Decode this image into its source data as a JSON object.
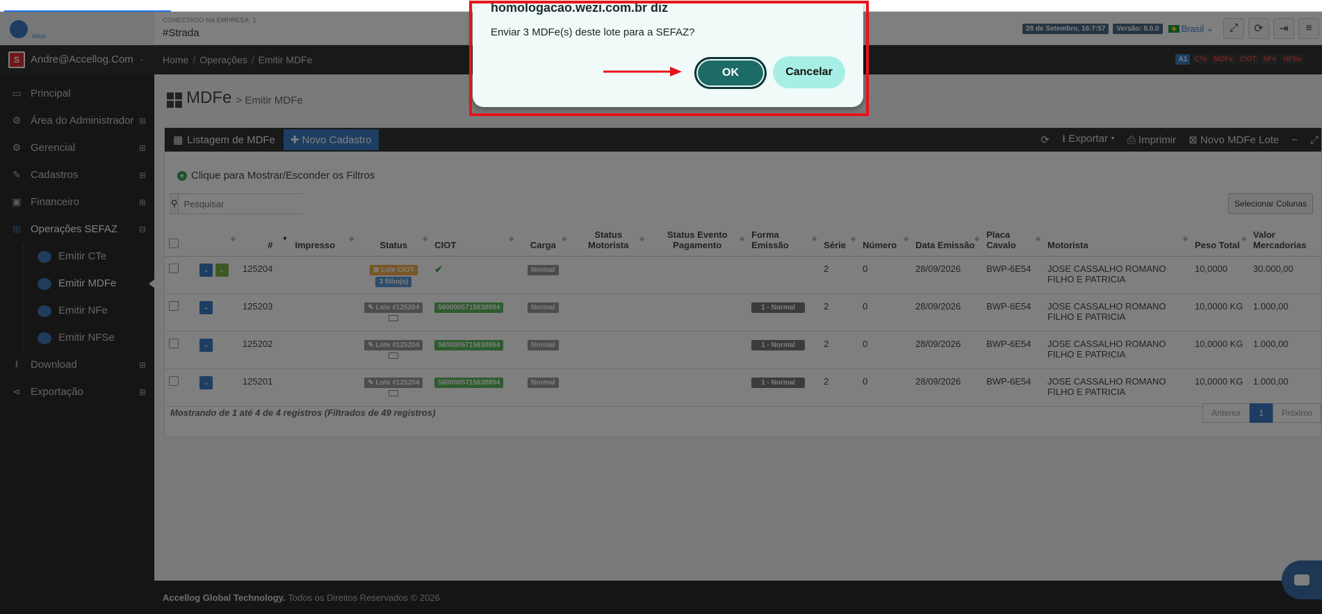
{
  "dialog": {
    "title": "homologacao.wezi.com.br diz",
    "message": "Enviar 3 MDFe(s) deste lote para a SEFAZ?",
    "ok_label": "OK",
    "cancel_label": "Cancelar"
  },
  "header": {
    "logo_text": "Wezi",
    "company_label": "CONECTADO NA EMPRESA: 1",
    "company_name": "#Strada",
    "date_badge": "28 de Setembro, 16:7:57",
    "version_badge": "Versão: 8.0.0",
    "country": "Brasil"
  },
  "sidebar": {
    "user": "Andre@Accellog.Com",
    "user_badge": "S",
    "items": [
      {
        "label": "Principal",
        "icon": "monitor-icon"
      },
      {
        "label": "Área do Administrador",
        "icon": "cogs-icon"
      },
      {
        "label": "Gerencial",
        "icon": "cogs-icon"
      },
      {
        "label": "Cadastros",
        "icon": "edit-icon"
      },
      {
        "label": "Financeiro",
        "icon": "money-icon"
      },
      {
        "label": "Operações SEFAZ",
        "icon": "windows-icon"
      },
      {
        "label": "Download",
        "icon": "download-icon"
      },
      {
        "label": "Exportação",
        "icon": "share-icon"
      }
    ],
    "sub_items": [
      {
        "label": "Emitir CTe",
        "tag": "CTe"
      },
      {
        "label": "Emitir MDFe",
        "tag": "MDFe"
      },
      {
        "label": "Emitir NFe",
        "tag": "NFe"
      },
      {
        "label": "Emitir NFSe",
        "tag": "NFSe"
      }
    ]
  },
  "breadcrumb": [
    "Home",
    "Operações",
    "Emitir MDFe"
  ],
  "quick_links": [
    "A1",
    "CTe",
    "MDFe",
    "CIOT",
    "NFe",
    "NFSe"
  ],
  "page": {
    "title": "MDFe",
    "subtitle": "> Emitir MDFe"
  },
  "panel": {
    "tab_list": "Listagem de MDFe",
    "tab_new": "Novo Cadastro",
    "export": "Exportar",
    "print": "Imprimir",
    "new_batch": "Novo MDFe Lote",
    "filter_toggle": "Clique para Mostrar/Esconder os Filtros",
    "search_placeholder": "Pesquisar",
    "select_columns": "Selecionar Colunas"
  },
  "table": {
    "columns": [
      "#",
      "Impresso",
      "Status",
      "CIOT",
      "Carga",
      "Status Motorista",
      "Status Evento Pagamento",
      "Forma Emissão",
      "Série",
      "Número",
      "Data Emissão",
      "Placa Cavalo",
      "Motorista",
      "Peso Total",
      "Valor Mercadorias"
    ],
    "rows": [
      {
        "id": "125204",
        "status": "Lote CIOT",
        "status_sub": "3 filho(s)",
        "ciot": "✔",
        "carga": "Normal",
        "forma": "",
        "serie": "2",
        "numero": "0",
        "data": "28/09/2026",
        "placa": "BWP-6E54",
        "motorista": "JOSE CASSALHO ROMANO FILHO E PATRICIA",
        "peso": "10,0000",
        "valor": "30.000,00"
      },
      {
        "id": "125203",
        "status": "Lote #125204",
        "status_sub": "",
        "ciot": "5600005715638894",
        "carga": "Normal",
        "forma": "1 - Normal",
        "serie": "2",
        "numero": "0",
        "data": "28/09/2026",
        "placa": "BWP-6E54",
        "motorista": "JOSE CASSALHO ROMANO FILHO E PATRICIA",
        "peso": "10,0000 KG",
        "valor": "1.000,00"
      },
      {
        "id": "125202",
        "status": "Lote #125204",
        "status_sub": "",
        "ciot": "5600005715638894",
        "carga": "Normal",
        "forma": "1 - Normal",
        "serie": "2",
        "numero": "0",
        "data": "28/09/2026",
        "placa": "BWP-6E54",
        "motorista": "JOSE CASSALHO ROMANO FILHO E PATRICIA",
        "peso": "10,0000 KG",
        "valor": "1.000,00"
      },
      {
        "id": "125201",
        "status": "Lote #125204",
        "status_sub": "",
        "ciot": "5600005715638894",
        "carga": "Normal",
        "forma": "1 - Normal",
        "serie": "2",
        "numero": "0",
        "data": "28/09/2026",
        "placa": "BWP-6E54",
        "motorista": "JOSE CASSALHO ROMANO FILHO E PATRICIA",
        "peso": "10,0000 KG",
        "valor": "1.000,00"
      }
    ],
    "footer_text": "Mostrando de 1 até 4 de 4 registros (Filtrados de 49 registros)",
    "pager": {
      "prev": "Anterior",
      "current": "1",
      "next": "Próximo"
    }
  },
  "footer": {
    "brand": "Accellog Global Technology.",
    "rights": "Todos os Direitos Reservados © 2026"
  },
  "colors": {
    "ok_button": "#1d6b67",
    "cancel_button": "#a7efe4",
    "highlight": "#e8121b",
    "accent": "#3b7dc4"
  }
}
